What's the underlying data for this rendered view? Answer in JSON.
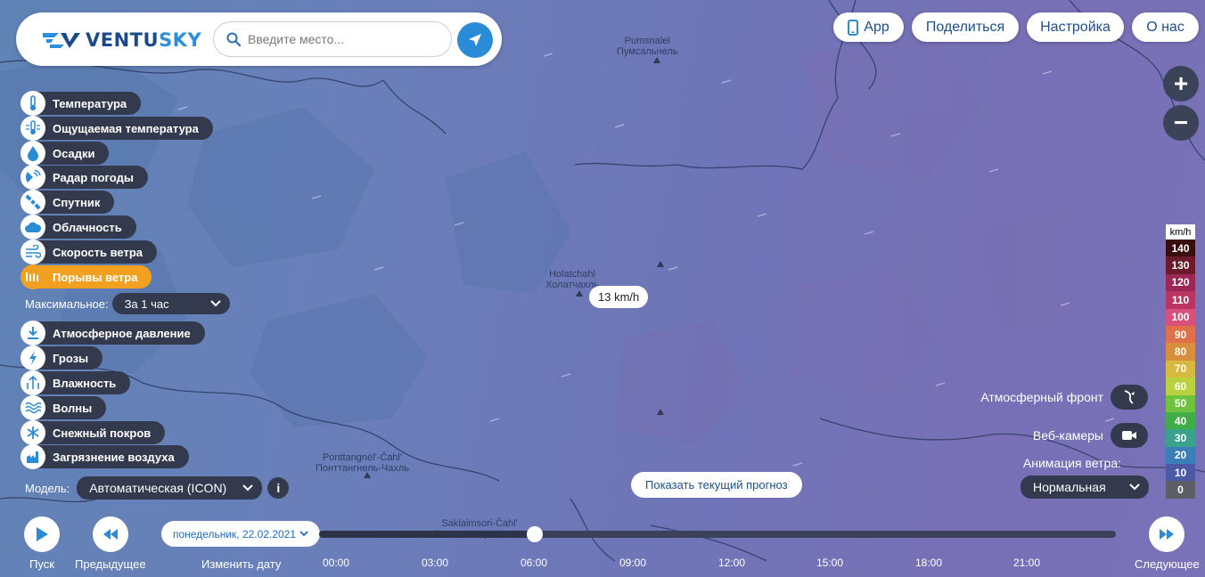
{
  "header": {
    "logo_part1": "VENTU",
    "logo_part2": "SKY",
    "search_placeholder": "Введите место..."
  },
  "top_buttons": {
    "app": "App",
    "share": "Поделиться",
    "settings": "Настройка",
    "about": "О нас"
  },
  "zoom": {
    "in": "+",
    "out": "−"
  },
  "layers": [
    {
      "label": "Температура",
      "icon": "thermometer-icon"
    },
    {
      "label": "Ощущаемая температура",
      "icon": "feels-like-icon"
    },
    {
      "label": "Осадки",
      "icon": "droplet-icon"
    },
    {
      "label": "Радар погоды",
      "icon": "radar-icon"
    },
    {
      "label": "Спутник",
      "icon": "satellite-icon"
    },
    {
      "label": "Облачность",
      "icon": "cloud-icon"
    },
    {
      "label": "Скорость ветра",
      "icon": "wind-icon"
    },
    {
      "label": "Порывы ветра",
      "icon": "wind-gust-icon",
      "active": true
    },
    {
      "label": "Атмосферное давление",
      "icon": "pressure-icon"
    },
    {
      "label": "Грозы",
      "icon": "lightning-icon"
    },
    {
      "label": "Влажность",
      "icon": "humidity-icon"
    },
    {
      "label": "Волны",
      "icon": "waves-icon"
    },
    {
      "label": "Снежный покров",
      "icon": "snowflake-icon"
    },
    {
      "label": "Загрязнение воздуха",
      "icon": "factory-icon"
    }
  ],
  "max_select": {
    "label": "Максимальное:",
    "value": "За 1 час"
  },
  "model_select": {
    "label": "Модель:",
    "value": "Автоматическая (ICON)",
    "info": "i"
  },
  "map": {
    "tooltip": "13 km/h",
    "show_forecast": "Показать текущий прогноз",
    "places": [
      {
        "line1": "Pumsnalel",
        "line2": "Пумсальнель"
      },
      {
        "line1": "Holatchahl",
        "line2": "Холатчахль"
      },
      {
        "line1": "Ponttangnel'-Čahl'",
        "line2": "Понттангнель-Чахль"
      },
      {
        "line1": "Saklaimsori-Čahl'",
        "line2": "Саклаимсори-Чахль"
      }
    ]
  },
  "right_panel": {
    "front_label": "Атмосферный фронт",
    "webcam_label": "Веб-камеры",
    "animation_label": "Анимация ветра:",
    "animation_value": "Нормальная"
  },
  "legend": {
    "unit": "km/h",
    "items": [
      {
        "value": "140",
        "color": "#3a0d0d"
      },
      {
        "value": "130",
        "color": "#6a1a2a"
      },
      {
        "value": "120",
        "color": "#9c2756"
      },
      {
        "value": "110",
        "color": "#bb3563"
      },
      {
        "value": "100",
        "color": "#d9517a"
      },
      {
        "value": "90",
        "color": "#e0704a"
      },
      {
        "value": "80",
        "color": "#d98e3c"
      },
      {
        "value": "70",
        "color": "#d6b93e"
      },
      {
        "value": "60",
        "color": "#b9d13e"
      },
      {
        "value": "50",
        "color": "#6fc23e"
      },
      {
        "value": "40",
        "color": "#3fae46"
      },
      {
        "value": "30",
        "color": "#3aa28a"
      },
      {
        "value": "20",
        "color": "#3a7fb8"
      },
      {
        "value": "10",
        "color": "#4a5aa6"
      },
      {
        "value": "0",
        "color": "#5d5d66"
      }
    ]
  },
  "timeline": {
    "play": "Пуск",
    "prev": "Предыдущее",
    "change_date": "Изменить дату",
    "next": "Следующее",
    "date": "понедельник, 22.02.2021",
    "hours": [
      "00:00",
      "03:00",
      "06:00",
      "09:00",
      "12:00",
      "15:00",
      "18:00",
      "21:00"
    ]
  }
}
